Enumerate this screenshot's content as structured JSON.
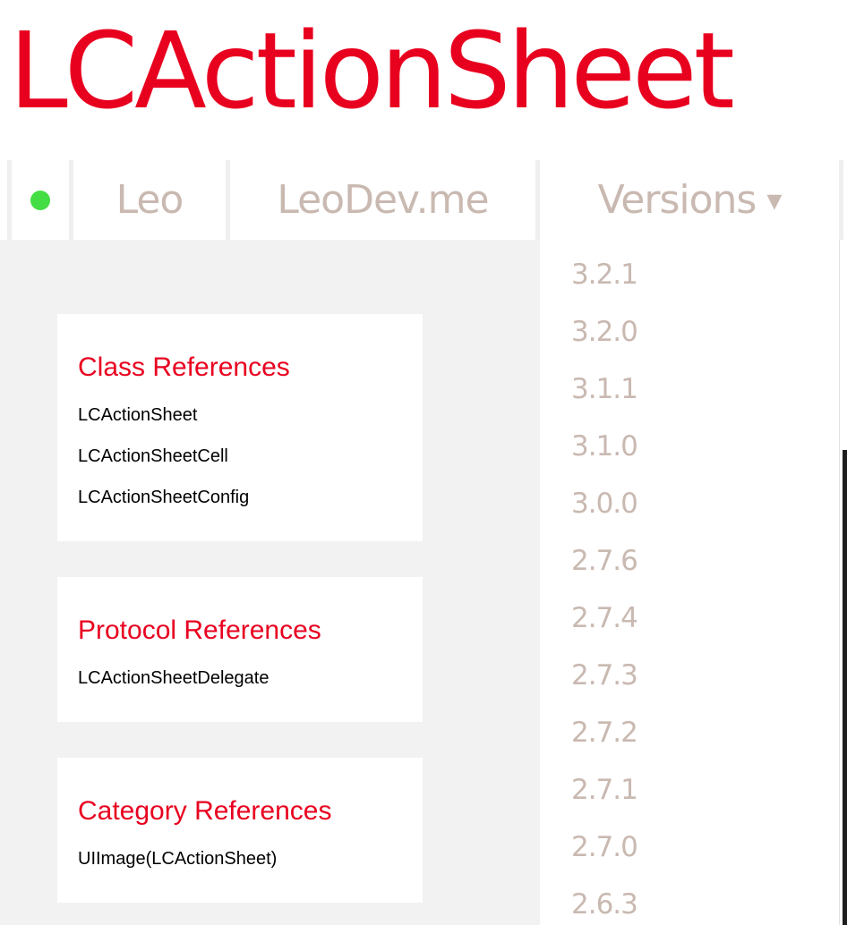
{
  "site": {
    "title": "LCActionSheet"
  },
  "nav": {
    "author": "Leo",
    "website": "LeoDev.me",
    "versions_label": "Versions",
    "versions_arrow": "▾"
  },
  "sections": [
    {
      "title": "Class References",
      "links": [
        "LCActionSheet",
        "LCActionSheetCell",
        "LCActionSheetConfig"
      ]
    },
    {
      "title": "Protocol References",
      "links": [
        "LCActionSheetDelegate"
      ]
    },
    {
      "title": "Category References",
      "links": [
        "UIImage(LCActionSheet)"
      ]
    }
  ],
  "versions": [
    "3.2.1",
    "3.2.0",
    "3.1.1",
    "3.1.0",
    "3.0.0",
    "2.7.6",
    "2.7.4",
    "2.7.3",
    "2.7.2",
    "2.7.1",
    "2.7.0",
    "2.6.3"
  ],
  "colors": {
    "brand_red": "#e8001f",
    "nav_text": "#c9b9b1",
    "status_dot": "#44dd44",
    "content_bg": "#f2f2f2"
  }
}
